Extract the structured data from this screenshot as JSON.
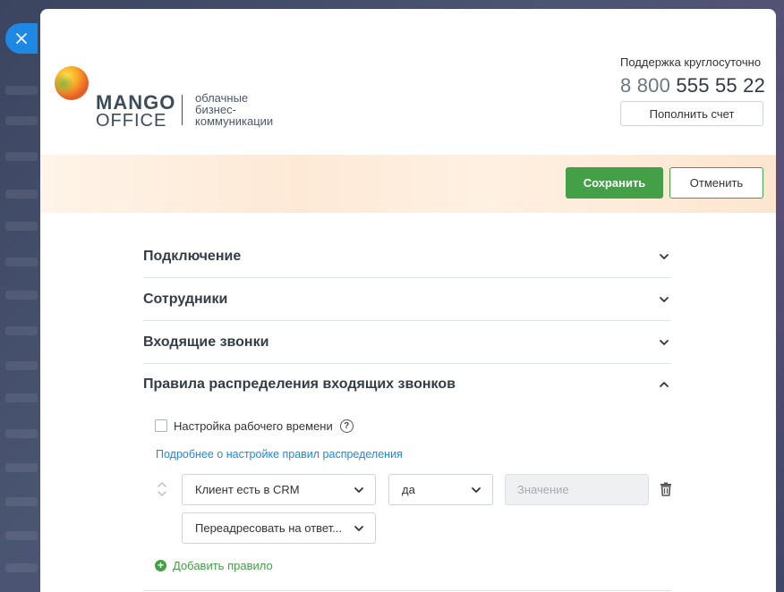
{
  "brand": {
    "name_line1": "MANGO",
    "name_line2": "OFFICE",
    "tagline": [
      "облачные",
      "бизнес-",
      "коммуникации"
    ]
  },
  "support": {
    "label": "Поддержка круглосуточно",
    "phone_prefix": "8 800",
    "phone_number": "555 55 22",
    "topup_label": "Пополнить счет"
  },
  "actions": {
    "save_label": "Сохранить",
    "cancel_label": "Отменить"
  },
  "sections": [
    {
      "title": "Подключение",
      "expanded": false
    },
    {
      "title": "Сотрудники",
      "expanded": false
    },
    {
      "title": "Входящие звонки",
      "expanded": false
    },
    {
      "title": "Правила распределения входящих звонков",
      "expanded": true
    }
  ],
  "rules_section": {
    "work_time_label": "Настройка рабочего времени",
    "help_glyph": "?",
    "info_link": "Подробнее о настройке правил распределения",
    "rule": {
      "condition": "Клиент есть в CRM",
      "operator": "да",
      "value_placeholder": "Значение",
      "action": "Переадресовать на ответ..."
    },
    "add_rule_label": "Добавить правило",
    "add_icon_glyph": "+"
  },
  "colors": {
    "accent_green": "#43a047",
    "link_blue": "#1e88e5",
    "close_blue": "#1e88e5"
  },
  "icons": {
    "close": "close-icon",
    "chevron_down": "chevron-down-icon",
    "chevron_up": "chevron-up-icon",
    "trash": "trash-icon",
    "reorder": "reorder-icon",
    "help": "help-icon",
    "add": "add-icon"
  }
}
